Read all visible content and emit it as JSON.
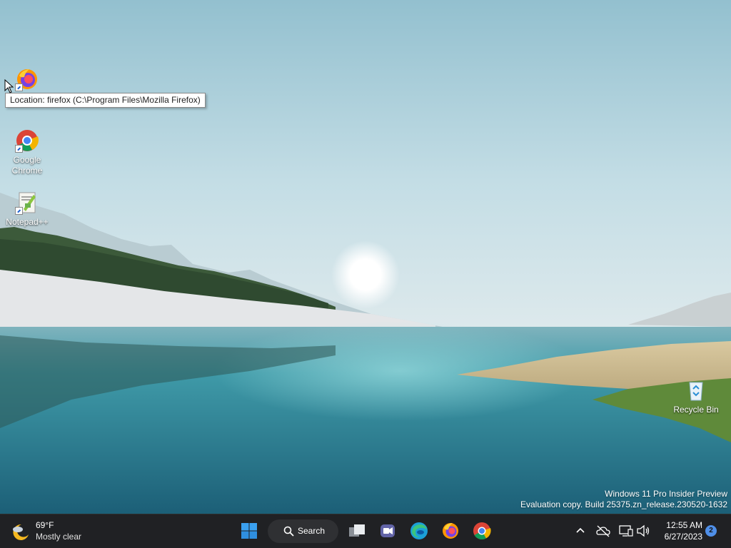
{
  "desktop": {
    "icons": [
      {
        "label": "",
        "icon": "firefox-icon"
      },
      {
        "label_line1": "Google",
        "label_line2": "Chrome",
        "icon": "chrome-icon"
      },
      {
        "label": "Notepad++",
        "icon": "notepadpp-icon"
      },
      {
        "label": "Recycle Bin",
        "icon": "recycle-bin-icon"
      }
    ],
    "tooltip": "Location: firefox (C:\\Program Files\\Mozilla Firefox)",
    "watermark": {
      "line1": "Windows 11 Pro Insider Preview",
      "line2": "Evaluation copy. Build 25375.zn_release.230520-1632"
    }
  },
  "taskbar": {
    "weather": {
      "temp": "69°F",
      "condition": "Mostly clear",
      "icon": "moon-cloud-icon"
    },
    "search_label": "Search",
    "pinned": [
      "start-icon",
      "task-view-icon",
      "teams-chat-icon",
      "edge-icon",
      "firefox-icon",
      "chrome-icon"
    ],
    "tray": [
      "chevron-up-icon",
      "onedrive-offline-icon",
      "network-icon",
      "volume-icon"
    ],
    "clock": {
      "time": "12:55 AM",
      "date": "6/27/2023"
    },
    "notifications": "2"
  },
  "colors": {
    "taskbar": "#202124",
    "accent": "#4f8fe8",
    "sky": "#a9cfd9",
    "water": "#2e8a9a"
  }
}
